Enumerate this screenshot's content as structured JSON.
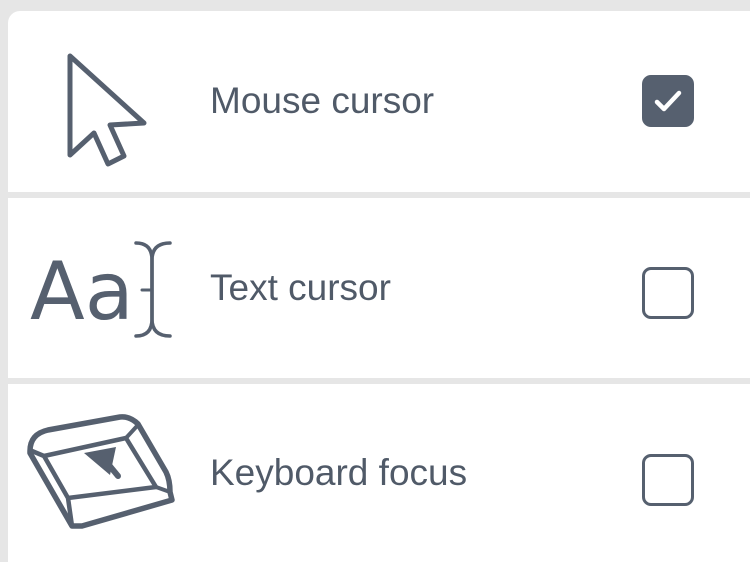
{
  "options": [
    {
      "label": "Mouse cursor",
      "icon": "mouse-pointer-icon",
      "checked": true
    },
    {
      "label": "Text cursor",
      "icon": "text-cursor-icon",
      "checked": false,
      "icon_text": "Aa"
    },
    {
      "label": "Keyboard focus",
      "icon": "keyboard-key-icon",
      "checked": false
    }
  ],
  "colors": {
    "icon": "#56606f",
    "text": "#505a68",
    "background": "#e6e6e6",
    "panel": "#ffffff"
  }
}
